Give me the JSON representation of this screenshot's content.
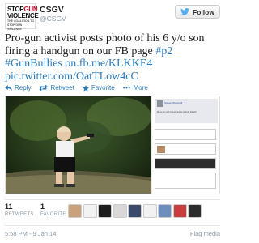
{
  "header": {
    "avatar_line1_a": "STOP",
    "avatar_line1_b": "GUN",
    "avatar_line2": "VIOLENCE",
    "avatar_line3": "THE COALITION TO STOP GUN VIOLENCE",
    "name": "CSGV",
    "handle": "@CSGV",
    "follow_label": "Follow"
  },
  "tweet": {
    "text": "Pro-gun activist posts photo of his 6 y/o son firing a handgun on our FB page ",
    "hashtag1": "#p2",
    "hashtag2": "#GunBullies",
    "link1": "on.fb.me/KLKKE4",
    "link2": "pic.twitter.com/OatTLow4cC"
  },
  "actions": {
    "reply": "Reply",
    "retweet": "Retweet",
    "favorite": "Favorite",
    "more": "More"
  },
  "media": {
    "fb_name": "Steven Woodruff",
    "fb_post": "Me & son with brand new sa (alfred) firewall"
  },
  "stats": {
    "retweets": "11",
    "retweets_label": "RETWEETS",
    "favorites": "1",
    "favorites_label": "FAVORITE"
  },
  "footer": {
    "timestamp": "5:58 PM - 9 Jan 14",
    "flag_label": "Flag media"
  },
  "colors": {
    "link": "#2b7bb9",
    "brand_red": "#c8102e",
    "muted": "#8899a6"
  }
}
